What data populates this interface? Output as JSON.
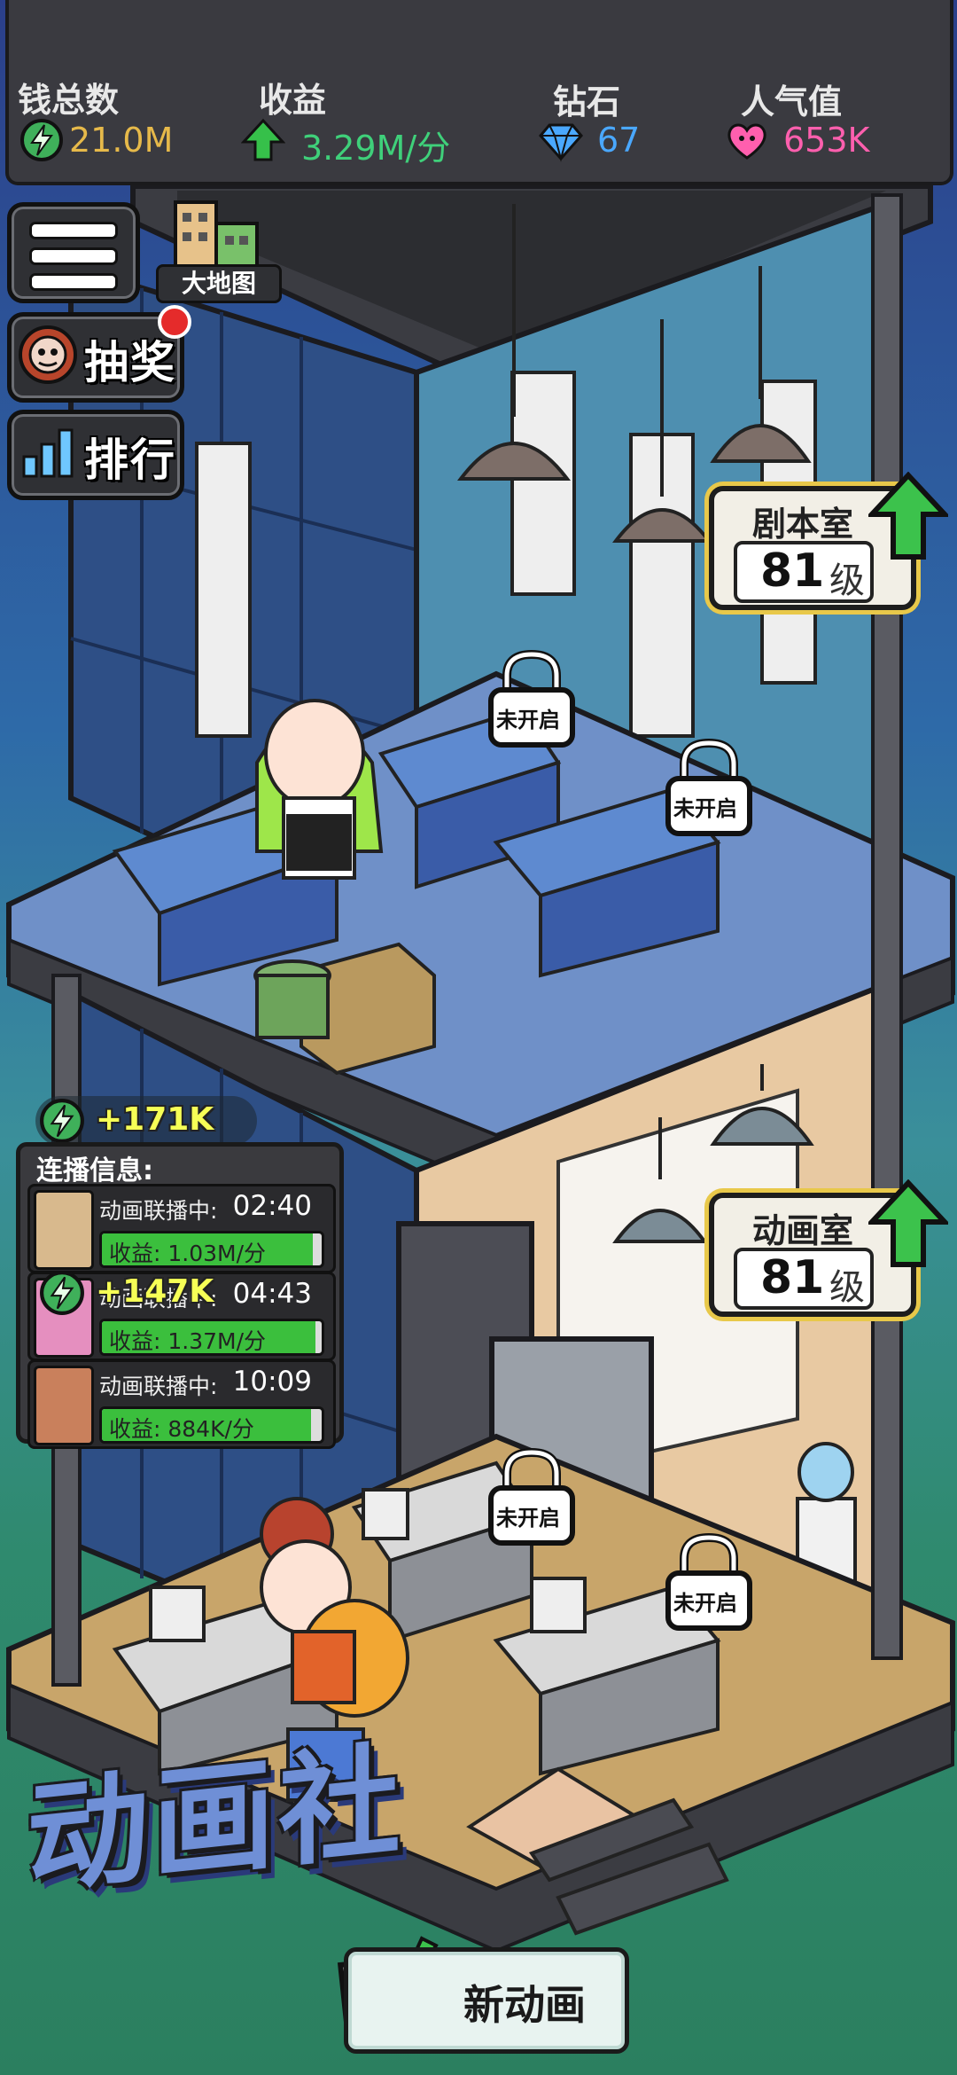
{
  "stats": {
    "money": {
      "label": "钱总数",
      "value": "21.0M",
      "icon": "lightning-coin-icon",
      "color": "#e6b94a"
    },
    "income": {
      "label": "收益",
      "value": "3.29M/分",
      "icon": "green-up-arrow-icon",
      "color": "#3fd07a"
    },
    "diamond": {
      "label": "钻石",
      "value": "67",
      "icon": "diamond-icon",
      "color": "#4aa8ff"
    },
    "popularity": {
      "label": "人气值",
      "value": "653K",
      "icon": "heart-icon",
      "color": "#ff5fae"
    }
  },
  "side": {
    "map_label": "大地图",
    "lottery_label": "抽奖",
    "rank_label": "排行"
  },
  "rooms": {
    "script": {
      "name": "剧本室",
      "level": "81",
      "unit": "级"
    },
    "animation": {
      "name": "动画室",
      "level": "81",
      "unit": "级"
    },
    "locked_label": "未开启"
  },
  "broadcast": {
    "title": "连播信息:",
    "gain_top": "+171K",
    "gain_mid": "+147K",
    "items": [
      {
        "status": "动画联播中:",
        "time": "02:40",
        "income": "收益: 1.03M/分",
        "progress": 0.96
      },
      {
        "status": "动画联播中:",
        "time": "04:43",
        "income": "收益: 1.37M/分",
        "progress": 0.97
      },
      {
        "status": "动画联播中:",
        "time": "10:09",
        "income": "收益: 884K/分",
        "progress": 0.95
      }
    ]
  },
  "studio_name": "动画社",
  "new_animation_label": "新动画"
}
